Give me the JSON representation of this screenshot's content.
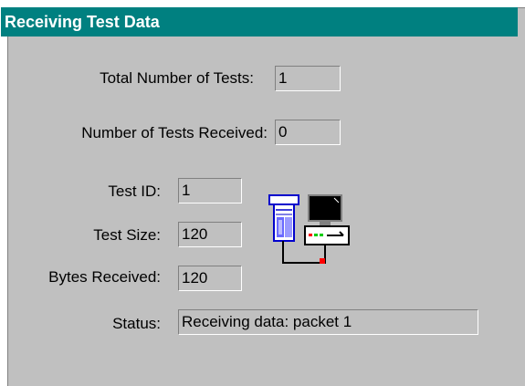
{
  "window": {
    "title": "Receiving Test Data"
  },
  "fields": {
    "total_tests": {
      "label": "Total Number of Tests:",
      "value": "1"
    },
    "tests_received": {
      "label": "Number of Tests Received:",
      "value": "0"
    },
    "test_id": {
      "label": "Test ID:",
      "value": "1"
    },
    "test_size": {
      "label": "Test Size:",
      "value": "120"
    },
    "bytes_received": {
      "label": "Bytes Received:",
      "value": "120"
    },
    "status": {
      "label": "Status:",
      "value": "Receiving data: packet 1"
    }
  },
  "icons": {
    "transfer": "device-to-computer-transfer-icon"
  },
  "colors": {
    "titlebar": "#008080",
    "face": "#c0c0c0"
  }
}
